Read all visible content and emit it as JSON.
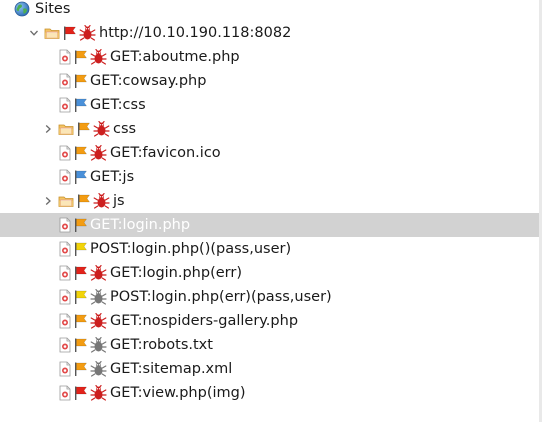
{
  "tree": {
    "colors": {
      "selection": "#d2d2d2",
      "flag_red": "#e2231a",
      "flag_orange": "#f39c12",
      "flag_yellow": "#f2d40a",
      "flag_blue": "#4a90d9",
      "bug_red": "#cc1f1f",
      "bug_gray": "#777777"
    },
    "rows": [
      {
        "label": "Sites",
        "depth": 0,
        "arrow": "none",
        "icons": [
          "globe-icon"
        ],
        "selected": false
      },
      {
        "label": "http://10.10.190.118:8082",
        "depth": 1,
        "arrow": "expanded",
        "icons": [
          "folder-icon",
          "red-flag-icon",
          "red-bug-icon"
        ],
        "selected": false
      },
      {
        "label": "GET:aboutme.php",
        "depth": 2,
        "arrow": "none",
        "icons": [
          "page-icon",
          "orange-flag-icon",
          "red-bug-icon"
        ],
        "selected": false
      },
      {
        "label": "GET:cowsay.php",
        "depth": 2,
        "arrow": "none",
        "icons": [
          "page-icon",
          "orange-flag-icon"
        ],
        "selected": false
      },
      {
        "label": "GET:css",
        "depth": 2,
        "arrow": "none",
        "icons": [
          "page-icon",
          "blue-flag-icon"
        ],
        "selected": false
      },
      {
        "label": "css",
        "depth": 2,
        "arrow": "collapsed",
        "icons": [
          "folder-icon",
          "orange-flag-icon",
          "red-bug-icon"
        ],
        "selected": false
      },
      {
        "label": "GET:favicon.ico",
        "depth": 2,
        "arrow": "none",
        "icons": [
          "page-icon",
          "orange-flag-icon",
          "red-bug-icon"
        ],
        "selected": false
      },
      {
        "label": "GET:js",
        "depth": 2,
        "arrow": "none",
        "icons": [
          "page-icon",
          "blue-flag-icon"
        ],
        "selected": false
      },
      {
        "label": "js",
        "depth": 2,
        "arrow": "collapsed",
        "icons": [
          "folder-icon",
          "orange-flag-icon",
          "red-bug-icon"
        ],
        "selected": false
      },
      {
        "label": "GET:login.php",
        "depth": 2,
        "arrow": "none",
        "icons": [
          "page-icon",
          "orange-flag-icon"
        ],
        "selected": true
      },
      {
        "label": "POST:login.php()(pass,user)",
        "depth": 2,
        "arrow": "none",
        "icons": [
          "page-icon",
          "yellow-flag-icon"
        ],
        "selected": false
      },
      {
        "label": "GET:login.php(err)",
        "depth": 2,
        "arrow": "none",
        "icons": [
          "page-icon",
          "red-flag-icon",
          "red-bug-icon"
        ],
        "selected": false
      },
      {
        "label": "POST:login.php(err)(pass,user)",
        "depth": 2,
        "arrow": "none",
        "icons": [
          "page-icon",
          "yellow-flag-icon",
          "gray-bug-icon"
        ],
        "selected": false
      },
      {
        "label": "GET:nospiders-gallery.php",
        "depth": 2,
        "arrow": "none",
        "icons": [
          "page-icon",
          "orange-flag-icon",
          "red-bug-icon"
        ],
        "selected": false
      },
      {
        "label": "GET:robots.txt",
        "depth": 2,
        "arrow": "none",
        "icons": [
          "page-icon",
          "orange-flag-icon",
          "gray-bug-icon"
        ],
        "selected": false
      },
      {
        "label": "GET:sitemap.xml",
        "depth": 2,
        "arrow": "none",
        "icons": [
          "page-icon",
          "orange-flag-icon",
          "gray-bug-icon"
        ],
        "selected": false
      },
      {
        "label": "GET:view.php(img)",
        "depth": 2,
        "arrow": "none",
        "icons": [
          "page-icon",
          "red-flag-icon",
          "red-bug-icon"
        ],
        "selected": false
      }
    ]
  }
}
